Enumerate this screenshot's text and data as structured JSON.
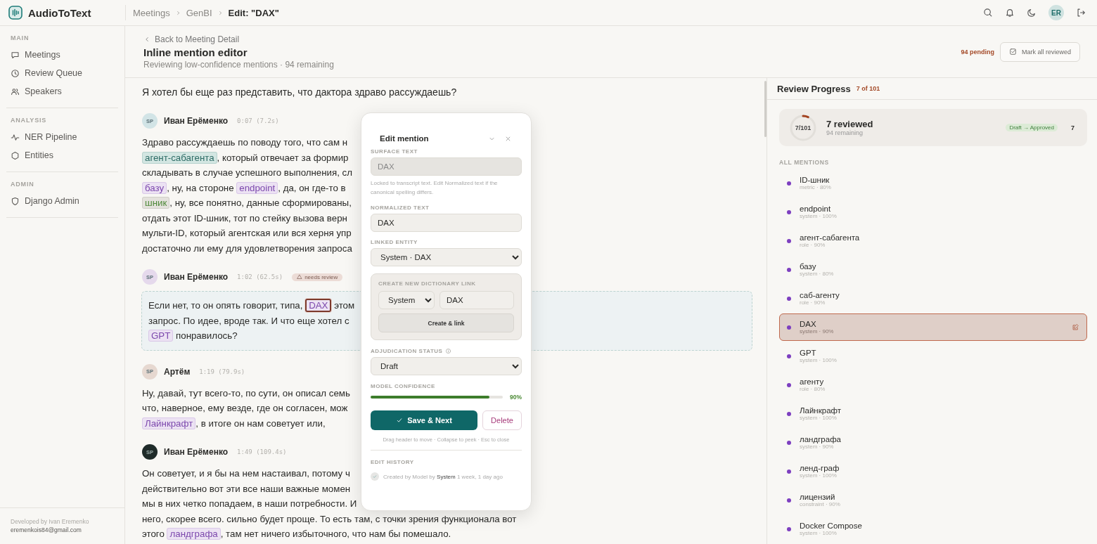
{
  "app": {
    "name": "AudioToText"
  },
  "breadcrumb": [
    {
      "label": "Meetings",
      "current": false
    },
    {
      "label": "GenBI",
      "current": false
    },
    {
      "label": "Edit: \"DAX\"",
      "current": true
    }
  ],
  "user": {
    "initials": "ER"
  },
  "sidebar": {
    "sections": [
      {
        "title": "MAIN",
        "items": [
          "Meetings",
          "Review Queue",
          "Speakers"
        ]
      },
      {
        "title": "ANALYSIS",
        "items": [
          "NER Pipeline",
          "Entities"
        ]
      },
      {
        "title": "ADMIN",
        "items": [
          "Django Admin"
        ]
      }
    ],
    "footer": {
      "credit": "Developed by Ivan Eremenko",
      "email": "eremenkois84@gmail.com"
    }
  },
  "page": {
    "back": "Back to Meeting Detail",
    "title": "Inline mention editor",
    "subtitle": "Reviewing low-confidence mentions · 94 remaining",
    "pending": "94 pending",
    "mark_all": "Mark all reviewed"
  },
  "transcript": {
    "intro": "Я хотел бы еще раз представить, что дактора здраво рассуждаешь?",
    "turns": [
      {
        "avatar": "SP",
        "color": "#d2e4e6",
        "speaker": "Иван Ерёменко",
        "time": "0:07 (7.2s)",
        "flagged": false,
        "lines": [
          [
            {
              "text": "Здраво рассуждаешь по поводу того, что сам н"
            }
          ],
          [
            {
              "mention": "агент-сабагента",
              "kind": "role",
              "selected": false
            },
            {
              "text": ", который отвечает за формир"
            }
          ],
          [
            {
              "text": "складывать в случае успешного выполнения, сл"
            }
          ],
          [
            {
              "mention": "базу",
              "kind": "system",
              "selected": false
            },
            {
              "text": ", ну, на стороне "
            },
            {
              "mention": "endpoint",
              "kind": "system",
              "selected": false
            },
            {
              "text": ", да, он где-то в"
            }
          ],
          [
            {
              "mention": "шник",
              "kind": "metric",
              "selected": false
            },
            {
              "text": ", ну, все понятно, данные сформированы,"
            }
          ],
          [
            {
              "text": "отдать этот ID-шник, тот по стейку вызова верн"
            }
          ],
          [
            {
              "text": "мульти-ID, который агентская или вся херня упр"
            }
          ],
          [
            {
              "text": "достаточно ли ему для удовлетворения запроса"
            }
          ]
        ]
      },
      {
        "avatar": "SP",
        "color": "#e5d9ec",
        "speaker": "Иван Ерёменко",
        "time": "1:02 (62.5s)",
        "flagged": true,
        "flag_label": "needs review",
        "lines": [
          [
            {
              "text": "Если нет, то он опять говорит, типа, "
            },
            {
              "mention": "DAX",
              "kind": "system",
              "selected": true
            },
            {
              "text": " этом"
            }
          ],
          [
            {
              "text": "запрос. По идее, вроде так. И что еще хотел с"
            }
          ],
          [
            {
              "mention": "GPT",
              "kind": "system",
              "selected": false
            },
            {
              "text": " понравилось?"
            }
          ]
        ]
      },
      {
        "avatar": "SP",
        "color": "#e6d8d0",
        "speaker": "Артём",
        "time": "1:19 (79.9s)",
        "flagged": false,
        "lines": [
          [
            {
              "text": "Ну, давай, тут всего-то, по сути, он описал семь"
            }
          ],
          [
            {
              "text": "что, наверное, ему везде, где он согласен, мож"
            }
          ],
          [
            {
              "mention": "Лайнкрафт",
              "kind": "system",
              "selected": false
            },
            {
              "text": ", в итоге он нам советует или,"
            }
          ]
        ]
      },
      {
        "avatar": "SP",
        "color": "#1f2b29",
        "speaker": "Иван Ерёменко",
        "time": "1:49 (109.4s)",
        "flagged": false,
        "lines": [
          [
            {
              "text": "Он советует, и я бы на нем настаивал, потому ч"
            }
          ],
          [
            {
              "text": "действительно вот эти все наши важные момен"
            }
          ],
          [
            {
              "text": "мы в них четко попадаем, в наши потребности. И"
            }
          ],
          [
            {
              "text": "него, скорее всего. сильно будет проще. То есть там, с точки зрения функционала вот"
            }
          ],
          [
            {
              "text": "этого "
            },
            {
              "mention": "ландграфа",
              "kind": "system",
              "selected": false
            },
            {
              "text": ", там нет ничего избыточного, что нам бы помешало."
            }
          ]
        ]
      }
    ]
  },
  "editor": {
    "title": "Edit mention",
    "surface": {
      "label": "SURFACE TEXT",
      "value": "DAX",
      "disabled": true,
      "help": "Locked to transcript text. Edit Normalized text if the canonical spelling differs."
    },
    "normalized": {
      "label": "NORMALIZED TEXT",
      "value": "DAX"
    },
    "linked": {
      "label": "LINKED ENTITY",
      "value": "System · DAX"
    },
    "create": {
      "title": "CREATE NEW DICTIONARY LINK",
      "type": "System",
      "name": "DAX",
      "button": "Create & link"
    },
    "status": {
      "label": "ADJUDICATION STATUS",
      "value": "Draft"
    },
    "confidence": {
      "label": "MODEL CONFIDENCE",
      "level": 0.9,
      "reading": "90%"
    },
    "save": "Save & Next",
    "delete": "Delete",
    "hint": "Drag header to move · Collapse to peek · Esc to close",
    "history": {
      "title": "EDIT HISTORY",
      "entries": [
        "Created by Model by **System** 1 week, 1 day ago"
      ]
    }
  },
  "progress": {
    "title": "Review Progress",
    "count": "7 of 101",
    "ring": "7/101",
    "level": 0.07,
    "reviewed": "7 reviewed",
    "remaining": "94 remaining",
    "transition": "Draft → Approved",
    "transition_count": "7",
    "list_title": "ALL MENTIONS",
    "mentions": [
      {
        "name": "ID-шник",
        "meta": "metric · 80%",
        "selected": false
      },
      {
        "name": "endpoint",
        "meta": "system · 100%",
        "selected": false
      },
      {
        "name": "агент-сабагента",
        "meta": "role · 90%",
        "selected": false
      },
      {
        "name": "базу",
        "meta": "system · 80%",
        "selected": false
      },
      {
        "name": "саб-агенту",
        "meta": "role · 90%",
        "selected": false
      },
      {
        "name": "DAX",
        "meta": "system · 90%",
        "selected": true
      },
      {
        "name": "GPT",
        "meta": "system · 100%",
        "selected": false
      },
      {
        "name": "агенту",
        "meta": "role · 80%",
        "selected": false
      },
      {
        "name": "Лайнкрафт",
        "meta": "system · 100%",
        "selected": false
      },
      {
        "name": "ландграфа",
        "meta": "system · 90%",
        "selected": false
      },
      {
        "name": "ленд-граф",
        "meta": "system · 100%",
        "selected": false
      },
      {
        "name": "лицензий",
        "meta": "constraint · 90%",
        "selected": false
      },
      {
        "name": "Docker Compose",
        "meta": "system · 100%",
        "selected": false
      }
    ]
  }
}
